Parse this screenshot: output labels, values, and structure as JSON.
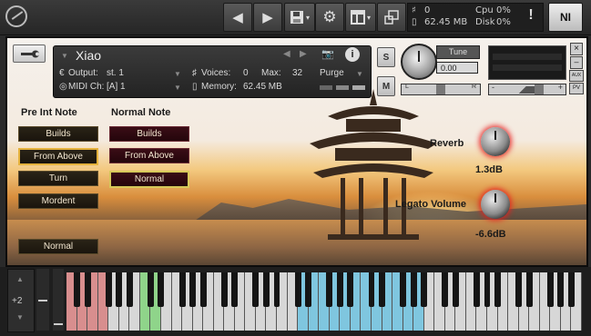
{
  "toolbar": {
    "nav_prev": "◀",
    "nav_next": "▶",
    "save_icon": "floppy-icon",
    "settings_icon": "gear-icon",
    "layout_icon": "layout-icon",
    "resize_icon": "resize-icon",
    "voices": "0",
    "memory": "62.45 MB",
    "cpu_label": "Cpu",
    "cpu_value": "0%",
    "disk_label": "Disk",
    "disk_value": "0%",
    "alert": "!",
    "ni_logo": "NI"
  },
  "header": {
    "name": "Xiao",
    "output_label": "Output:",
    "output_value": "st. 1",
    "midi_label": "MIDI Ch:",
    "midi_value": "[A] 1",
    "voices_label": "Voices:",
    "voices_value": "0",
    "max_label": "Max:",
    "max_value": "32",
    "memory_label": "Memory:",
    "memory_value": "62.45 MB",
    "purge": "Purge",
    "solo": "S",
    "mute": "M",
    "tune_label": "Tune",
    "tune_value": "0.00",
    "pan_left": "L",
    "pan_right": "R",
    "vol_minus": "-",
    "vol_plus": "+",
    "close": "×",
    "aux": "AUX",
    "pv": "PV",
    "info": "i"
  },
  "panel": {
    "pre_int_title": "Pre Int Note",
    "normal_title": "Normal Note",
    "pre_buttons": [
      "Builds",
      "From Above",
      "Turn",
      "Mordent"
    ],
    "normal_buttons": [
      "Builds",
      "From Above",
      "Normal"
    ],
    "bottom_button": "Normal",
    "reverb_label": "Reverb",
    "reverb_value": "1.3dB",
    "legato_label": "Legato Volume",
    "legato_value": "-6.6dB"
  },
  "keyboard": {
    "octave": "+2"
  },
  "colors": {
    "key_red": "#d88e8e",
    "key_green": "#8fd48a",
    "key_blue": "#7fc6df",
    "button_border_selected": "#e5b23c"
  }
}
